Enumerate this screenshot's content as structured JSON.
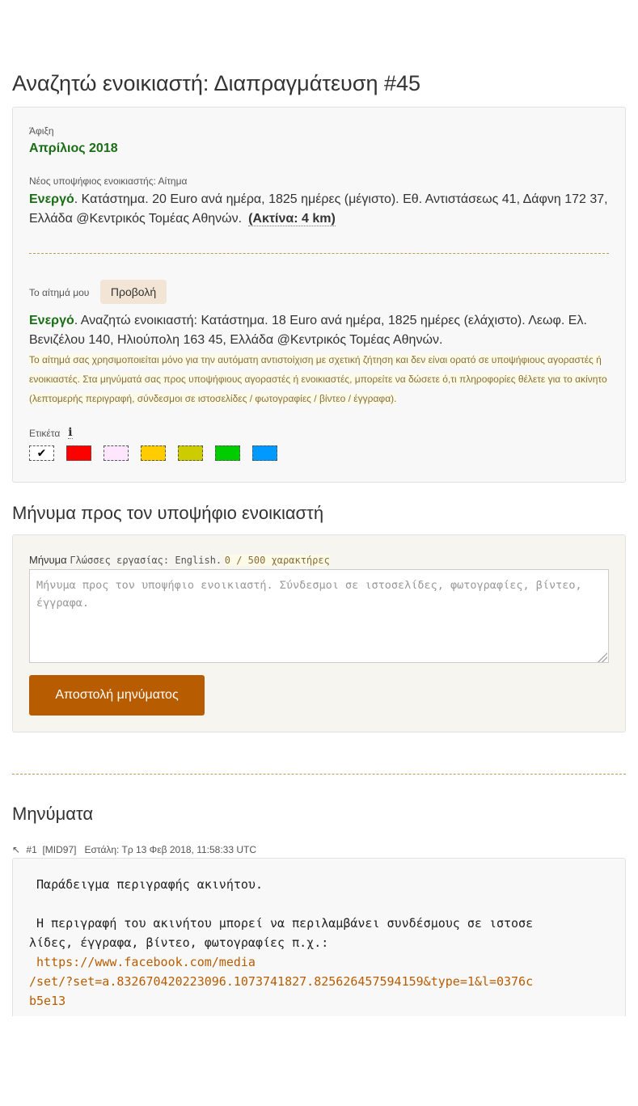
{
  "page": {
    "title": "Αναζητώ ενοικιαστή: Διαπραγμάτευση #45"
  },
  "deal": {
    "arrival_label": "Άφιξη",
    "arrival_value": "Απρίλιος 2018",
    "candidate_label": "Νέος υποψήφιος ενοικιαστής: Αίτημα",
    "candidate_status": "Ενεργό",
    "candidate_text": ". Κατάστημα. 20 Euro ανά ημέρα, 1825 ημέρες (μέγιστο). Εθ. Αντιστάσεως 41, Δάφνη 172 37, Ελλάδα @Κεντρικός Τομέας Αθηνών.",
    "radius_text": "(Ακτίνα:  4 km)",
    "my_request_label": "Το αίτημά μου",
    "preview_button": "Προβολή",
    "my_status": "Ενεργό",
    "my_text": ". Αναζητώ ενοικιαστή: Κατάστημα. 18 Euro ανά ημέρα, 1825 ημέρες (ελάχιστο). Λεωφ. Ελ. Βενιζέλου 140, Ηλιούπολη 163 45, Ελλάδα @Κεντρικός Τομέας Αθηνών.",
    "notice": "Το αίτημά σας χρησιμοποιείται μόνο για την αυτόματη αντιστοίχιση με σχετική ζήτηση και δεν είναι ορατό σε υποψήφιους αγοραστές ή ενοικιαστές. Στα μηνύματά σας προς υποψήφιους αγοραστές ή ενοικιαστές, μπορείτε να δώσετε ό,τι πληροφορίες θέλετε για το ακίνητο (λεπτομερής περιγραφή, σύνδεσμοι σε ιστοσελίδες / φωτογραφίες / βίντεο / έγγραφα).",
    "tag_label": "Ετικέτα",
    "info_icon": "i",
    "swatches": [
      {
        "color": "#ffffff",
        "mark": "✔"
      },
      {
        "color": "#ff0000",
        "mark": ""
      },
      {
        "color": "#ffe6ff",
        "mark": ""
      },
      {
        "color": "#ffcc00",
        "mark": ""
      },
      {
        "color": "#cccc00",
        "mark": ""
      },
      {
        "color": "#00cc00",
        "mark": ""
      },
      {
        "color": "#0099ff",
        "mark": ""
      }
    ]
  },
  "compose": {
    "title": "Μήνυμα προς τον υποψήφιο ενοικιαστή",
    "field_label": "Μήνυμα",
    "languages": "Γλώσσες εργασίας: English.",
    "char_count": "0 / 500 χαρακτήρες",
    "placeholder": "Μήνυμα προς τον υποψήφιο ενοικιαστή. Σύνδεσμοι σε ιστοσελίδες, φωτογραφίες, βίντεο, έγγραφα.",
    "send_button": "Αποστολή μηνύματος"
  },
  "messages": {
    "title": "Μηνύματα",
    "items": [
      {
        "arrow": "↖",
        "number": "#1",
        "mid": "[MID97]",
        "sent": "Εστάλη: Τρ 13 Φεβ 2018, 11:58:33 UTC",
        "line1": " Παράδειγμα περιγραφής ακινήτου.",
        "line2": " Η περιγραφή του ακινήτου μπορεί να περιλαμβάνει συνδέσμους σε ιστοσελίδες, έγγραφα, βίντεο, φωτογραφίες π.χ.:",
        "link_part1": " https://www.facebook.com/media",
        "link_part2": "/set/?set=a.832670420223096.1073741827.825626457594159&type=1&l=0376cb5e13"
      }
    ]
  },
  "colors": {
    "accent": "#b85c00",
    "status_green": "#1a6e16",
    "divider": "#c29a55",
    "notice_text": "#8a6d3b"
  }
}
